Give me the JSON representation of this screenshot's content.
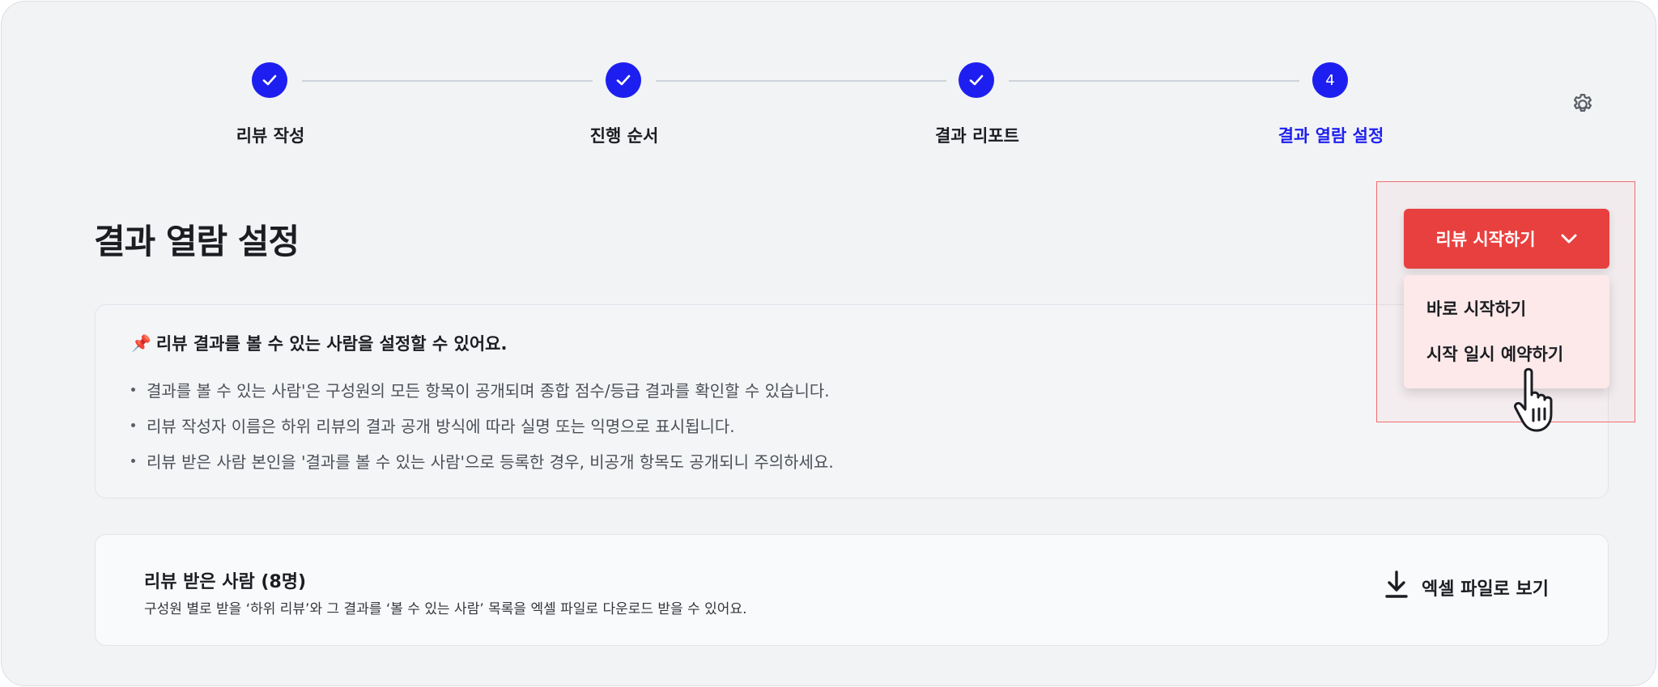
{
  "stepper": {
    "steps": [
      {
        "label": "리뷰 작성",
        "status": "completed"
      },
      {
        "label": "진행 순서",
        "status": "completed"
      },
      {
        "label": "결과 리포트",
        "status": "completed"
      },
      {
        "label": "결과 열람 설정",
        "status": "current",
        "number": "4"
      }
    ],
    "colors": {
      "accent": "#1d1ff0",
      "line": "#cfd3da"
    }
  },
  "settings": {
    "icon": "gear-icon"
  },
  "page": {
    "title": "결과 열람 설정"
  },
  "info": {
    "title": "리뷰 결과를 볼 수 있는 사람을 설정할 수 있어요.",
    "icon": "pushpin-icon",
    "bullets": [
      "결과를 볼 수 있는 사람'은 구성원의 모든 항목이 공개되며 종합 점수/등급 결과를 확인할 수 있습니다.",
      "리뷰 작성자 이름은 하위 리뷰의 결과 공개 방식에 따라 실명 또는 익명으로 표시됩니다.",
      "리뷰 받은 사람 본인을 '결과를 볼 수 있는 사람'으로 등록한 경우, 비공개 항목도 공개되니 주의하세요."
    ]
  },
  "reviewees": {
    "title": "리뷰 받은 사람 (8명)",
    "description": "구성원 별로 받을 ‘하위 리뷰’와 그 결과를 ‘볼 수 있는 사람’ 목록을 엑셀 파일로 다운로드 받을 수 있어요.",
    "excel_label": "엑셀 파일로 보기",
    "excel_icon": "download-icon"
  },
  "start": {
    "button_label": "리뷰 시작하기",
    "chevron_icon": "chevron-down-icon",
    "color": "#e8403f",
    "menu": [
      "바로 시작하기",
      "시작 일시 예약하기"
    ],
    "menu_bg": "#fde9e9"
  }
}
